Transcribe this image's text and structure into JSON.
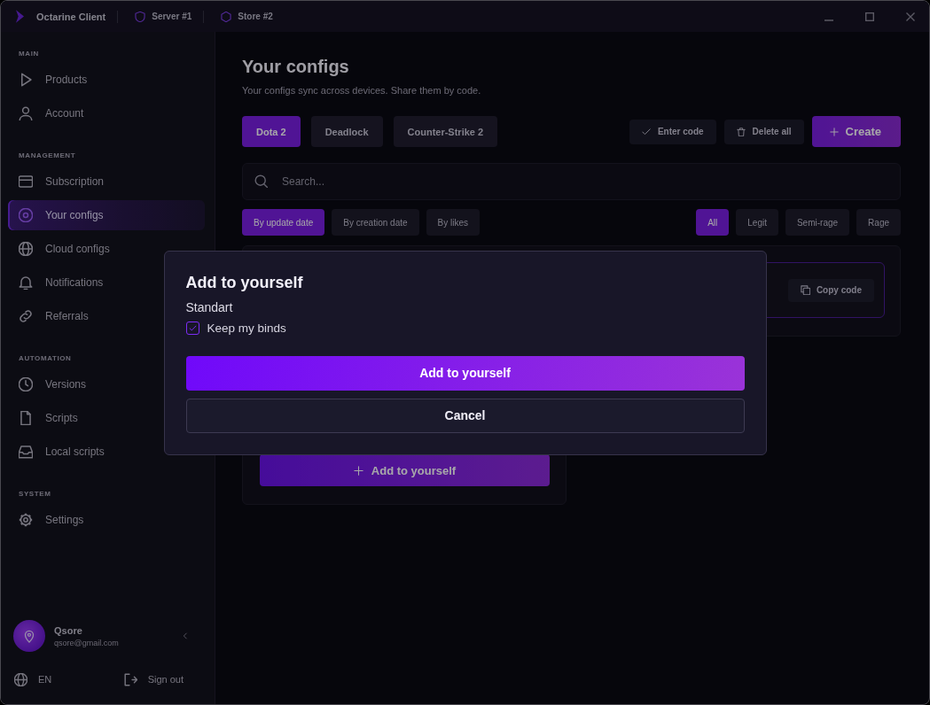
{
  "title_bar": {
    "app_name": "Octarine Client",
    "links": [
      {
        "label": "Server #1"
      },
      {
        "label": "Store #2"
      }
    ]
  },
  "sidebar": {
    "sections": [
      {
        "title": "MAIN",
        "items": [
          {
            "label": "Products",
            "selected": false
          },
          {
            "label": "Account",
            "selected": false
          }
        ]
      },
      {
        "title": "MANAGEMENT",
        "items": [
          {
            "label": "Subscription",
            "selected": false
          },
          {
            "label": "Your configs",
            "selected": true
          },
          {
            "label": "Cloud configs",
            "selected": false
          },
          {
            "label": "Notifications",
            "selected": false
          },
          {
            "label": "Referrals",
            "selected": false
          }
        ]
      },
      {
        "title": "AUTOMATION",
        "items": [
          {
            "label": "Versions",
            "selected": false
          },
          {
            "label": "Scripts",
            "selected": false
          },
          {
            "label": "Local scripts",
            "selected": false
          }
        ]
      },
      {
        "title": "SYSTEM",
        "items": [
          {
            "label": "Settings",
            "selected": false
          }
        ]
      }
    ],
    "user": {
      "name": "Qsore",
      "email": "qsore@gmail.com"
    },
    "language": "EN",
    "sign_out": "Sign out"
  },
  "page": {
    "title": "Your configs",
    "subtitle": "Your configs sync across devices. Share them by code.",
    "game_tabs": [
      {
        "label": "Dota 2",
        "selected": true
      },
      {
        "label": "Deadlock",
        "selected": false
      },
      {
        "label": "Counter-Strike 2",
        "selected": false
      }
    ],
    "actions": [
      {
        "label": "Enter code",
        "kind": "secondary"
      },
      {
        "label": "Delete all",
        "kind": "secondary"
      },
      {
        "label": "Create",
        "kind": "primary"
      }
    ],
    "search": {
      "placeholder": "Search..."
    },
    "sort_options": [
      {
        "label": "By update date",
        "selected": true
      },
      {
        "label": "By creation date",
        "selected": false
      },
      {
        "label": "By likes",
        "selected": false
      }
    ],
    "filters": [
      {
        "label": "All",
        "selected": true
      },
      {
        "label": "Legit",
        "selected": false
      },
      {
        "label": "Semi-rage",
        "selected": false
      },
      {
        "label": "Rage",
        "selected": false
      }
    ],
    "config_cards": [
      {
        "kind": "copy",
        "button": "Copy code"
      },
      {
        "kind": "add",
        "button": "Add to yourself"
      }
    ]
  },
  "modal": {
    "title": "Add to yourself",
    "config_name": "Standart",
    "keep_binds": {
      "label": "Keep my binds",
      "checked": true
    },
    "confirm": "Add to yourself",
    "cancel": "Cancel"
  }
}
